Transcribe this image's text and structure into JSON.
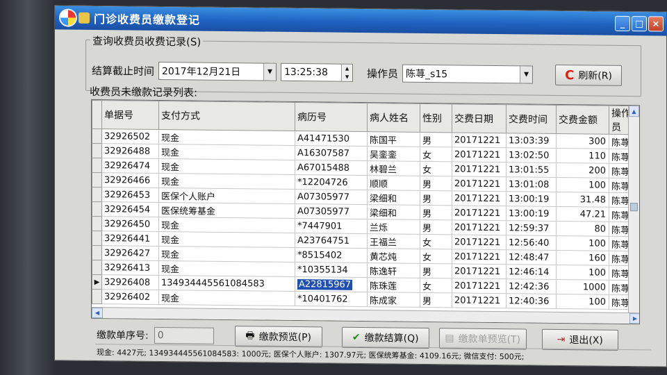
{
  "window": {
    "title": "门诊收费员缴款登记"
  },
  "query": {
    "group_label": "查询收费员收费记录(S)",
    "date_label": "结算截止时间",
    "date_value": "2017年12月21日",
    "time_value": "13:25:38",
    "operator_label": "操作员",
    "operator_value": "陈荨_s15",
    "refresh_label": "刷新(R)"
  },
  "list": {
    "caption": "收费员未缴款记录列表:",
    "columns": [
      "单据号",
      "支付方式",
      "病历号",
      "病人姓名",
      "性别",
      "交费日期",
      "交费时间",
      "交费金额",
      "操作员"
    ],
    "rows": [
      [
        "32926502",
        "现金",
        "A41471530",
        "陈国平",
        "男",
        "20171221",
        "13:03:39",
        "300",
        "陈荨"
      ],
      [
        "32926488",
        "现金",
        "A16307587",
        "吴銮銮",
        "女",
        "20171221",
        "13:02:50",
        "110",
        "陈荨"
      ],
      [
        "32926474",
        "现金",
        "A67015488",
        "林碧兰",
        "女",
        "20171221",
        "13:01:55",
        "200",
        "陈荨"
      ],
      [
        "32926466",
        "现金",
        "*12204726",
        "顺顺",
        "男",
        "20171221",
        "13:01:08",
        "100",
        "陈荨"
      ],
      [
        "32926453",
        "医保个人账户",
        "A07305977",
        "梁细和",
        "男",
        "20171221",
        "13:00:19",
        "31.48",
        "陈荨"
      ],
      [
        "32926454",
        "医保统筹基金",
        "A07305977",
        "梁细和",
        "男",
        "20171221",
        "13:00:19",
        "47.21",
        "陈荨"
      ],
      [
        "32926450",
        "现金",
        "*7447901",
        "兰烁",
        "男",
        "20171221",
        "12:59:37",
        "80",
        "陈荨"
      ],
      [
        "32926441",
        "现金",
        "A23764751",
        "王福兰",
        "女",
        "20171221",
        "12:56:40",
        "100",
        "陈荨"
      ],
      [
        "32926427",
        "现金",
        "*8515402",
        "黄芯炖",
        "女",
        "20171221",
        "12:48:47",
        "160",
        "陈荨"
      ],
      [
        "32926413",
        "现金",
        "*10355134",
        "陈逸轩",
        "男",
        "20171221",
        "12:46:14",
        "100",
        "陈荨"
      ],
      [
        "32926408",
        "134934445561084583",
        "A22815967",
        "陈珠莲",
        "女",
        "20171221",
        "12:42:36",
        "1000",
        "陈荨"
      ],
      [
        "32926402",
        "现金",
        "*10401762",
        "陈成家",
        "男",
        "20171221",
        "12:40:36",
        "100",
        "陈荨"
      ]
    ],
    "selected_row": 10
  },
  "footer": {
    "serial_label": "缴款单序号:",
    "serial_value": "0",
    "preview_label": "缴款预览(P)",
    "settle_label": "缴款结算(Q)",
    "third_label": "缴款单预览(T)",
    "exit_label": "退出(X)"
  },
  "status": "现金: 4427元; 134934445561084583: 1000元; 医保个人账户: 1307.97元; 医保统筹基金: 4109.16元; 微信支付: 500元;"
}
